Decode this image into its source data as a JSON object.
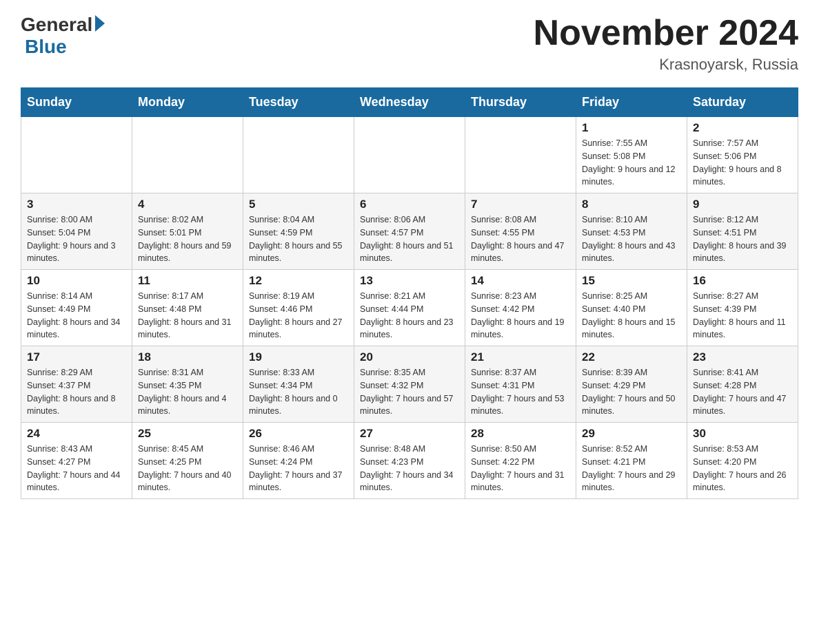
{
  "header": {
    "logo": {
      "general": "General",
      "blue": "Blue"
    },
    "title": "November 2024",
    "subtitle": "Krasnoyarsk, Russia"
  },
  "weekdays": [
    "Sunday",
    "Monday",
    "Tuesday",
    "Wednesday",
    "Thursday",
    "Friday",
    "Saturday"
  ],
  "weeks": [
    [
      {
        "day": "",
        "sunrise": "",
        "sunset": "",
        "daylight": ""
      },
      {
        "day": "",
        "sunrise": "",
        "sunset": "",
        "daylight": ""
      },
      {
        "day": "",
        "sunrise": "",
        "sunset": "",
        "daylight": ""
      },
      {
        "day": "",
        "sunrise": "",
        "sunset": "",
        "daylight": ""
      },
      {
        "day": "",
        "sunrise": "",
        "sunset": "",
        "daylight": ""
      },
      {
        "day": "1",
        "sunrise": "Sunrise: 7:55 AM",
        "sunset": "Sunset: 5:08 PM",
        "daylight": "Daylight: 9 hours and 12 minutes."
      },
      {
        "day": "2",
        "sunrise": "Sunrise: 7:57 AM",
        "sunset": "Sunset: 5:06 PM",
        "daylight": "Daylight: 9 hours and 8 minutes."
      }
    ],
    [
      {
        "day": "3",
        "sunrise": "Sunrise: 8:00 AM",
        "sunset": "Sunset: 5:04 PM",
        "daylight": "Daylight: 9 hours and 3 minutes."
      },
      {
        "day": "4",
        "sunrise": "Sunrise: 8:02 AM",
        "sunset": "Sunset: 5:01 PM",
        "daylight": "Daylight: 8 hours and 59 minutes."
      },
      {
        "day": "5",
        "sunrise": "Sunrise: 8:04 AM",
        "sunset": "Sunset: 4:59 PM",
        "daylight": "Daylight: 8 hours and 55 minutes."
      },
      {
        "day": "6",
        "sunrise": "Sunrise: 8:06 AM",
        "sunset": "Sunset: 4:57 PM",
        "daylight": "Daylight: 8 hours and 51 minutes."
      },
      {
        "day": "7",
        "sunrise": "Sunrise: 8:08 AM",
        "sunset": "Sunset: 4:55 PM",
        "daylight": "Daylight: 8 hours and 47 minutes."
      },
      {
        "day": "8",
        "sunrise": "Sunrise: 8:10 AM",
        "sunset": "Sunset: 4:53 PM",
        "daylight": "Daylight: 8 hours and 43 minutes."
      },
      {
        "day": "9",
        "sunrise": "Sunrise: 8:12 AM",
        "sunset": "Sunset: 4:51 PM",
        "daylight": "Daylight: 8 hours and 39 minutes."
      }
    ],
    [
      {
        "day": "10",
        "sunrise": "Sunrise: 8:14 AM",
        "sunset": "Sunset: 4:49 PM",
        "daylight": "Daylight: 8 hours and 34 minutes."
      },
      {
        "day": "11",
        "sunrise": "Sunrise: 8:17 AM",
        "sunset": "Sunset: 4:48 PM",
        "daylight": "Daylight: 8 hours and 31 minutes."
      },
      {
        "day": "12",
        "sunrise": "Sunrise: 8:19 AM",
        "sunset": "Sunset: 4:46 PM",
        "daylight": "Daylight: 8 hours and 27 minutes."
      },
      {
        "day": "13",
        "sunrise": "Sunrise: 8:21 AM",
        "sunset": "Sunset: 4:44 PM",
        "daylight": "Daylight: 8 hours and 23 minutes."
      },
      {
        "day": "14",
        "sunrise": "Sunrise: 8:23 AM",
        "sunset": "Sunset: 4:42 PM",
        "daylight": "Daylight: 8 hours and 19 minutes."
      },
      {
        "day": "15",
        "sunrise": "Sunrise: 8:25 AM",
        "sunset": "Sunset: 4:40 PM",
        "daylight": "Daylight: 8 hours and 15 minutes."
      },
      {
        "day": "16",
        "sunrise": "Sunrise: 8:27 AM",
        "sunset": "Sunset: 4:39 PM",
        "daylight": "Daylight: 8 hours and 11 minutes."
      }
    ],
    [
      {
        "day": "17",
        "sunrise": "Sunrise: 8:29 AM",
        "sunset": "Sunset: 4:37 PM",
        "daylight": "Daylight: 8 hours and 8 minutes."
      },
      {
        "day": "18",
        "sunrise": "Sunrise: 8:31 AM",
        "sunset": "Sunset: 4:35 PM",
        "daylight": "Daylight: 8 hours and 4 minutes."
      },
      {
        "day": "19",
        "sunrise": "Sunrise: 8:33 AM",
        "sunset": "Sunset: 4:34 PM",
        "daylight": "Daylight: 8 hours and 0 minutes."
      },
      {
        "day": "20",
        "sunrise": "Sunrise: 8:35 AM",
        "sunset": "Sunset: 4:32 PM",
        "daylight": "Daylight: 7 hours and 57 minutes."
      },
      {
        "day": "21",
        "sunrise": "Sunrise: 8:37 AM",
        "sunset": "Sunset: 4:31 PM",
        "daylight": "Daylight: 7 hours and 53 minutes."
      },
      {
        "day": "22",
        "sunrise": "Sunrise: 8:39 AM",
        "sunset": "Sunset: 4:29 PM",
        "daylight": "Daylight: 7 hours and 50 minutes."
      },
      {
        "day": "23",
        "sunrise": "Sunrise: 8:41 AM",
        "sunset": "Sunset: 4:28 PM",
        "daylight": "Daylight: 7 hours and 47 minutes."
      }
    ],
    [
      {
        "day": "24",
        "sunrise": "Sunrise: 8:43 AM",
        "sunset": "Sunset: 4:27 PM",
        "daylight": "Daylight: 7 hours and 44 minutes."
      },
      {
        "day": "25",
        "sunrise": "Sunrise: 8:45 AM",
        "sunset": "Sunset: 4:25 PM",
        "daylight": "Daylight: 7 hours and 40 minutes."
      },
      {
        "day": "26",
        "sunrise": "Sunrise: 8:46 AM",
        "sunset": "Sunset: 4:24 PM",
        "daylight": "Daylight: 7 hours and 37 minutes."
      },
      {
        "day": "27",
        "sunrise": "Sunrise: 8:48 AM",
        "sunset": "Sunset: 4:23 PM",
        "daylight": "Daylight: 7 hours and 34 minutes."
      },
      {
        "day": "28",
        "sunrise": "Sunrise: 8:50 AM",
        "sunset": "Sunset: 4:22 PM",
        "daylight": "Daylight: 7 hours and 31 minutes."
      },
      {
        "day": "29",
        "sunrise": "Sunrise: 8:52 AM",
        "sunset": "Sunset: 4:21 PM",
        "daylight": "Daylight: 7 hours and 29 minutes."
      },
      {
        "day": "30",
        "sunrise": "Sunrise: 8:53 AM",
        "sunset": "Sunset: 4:20 PM",
        "daylight": "Daylight: 7 hours and 26 minutes."
      }
    ]
  ]
}
